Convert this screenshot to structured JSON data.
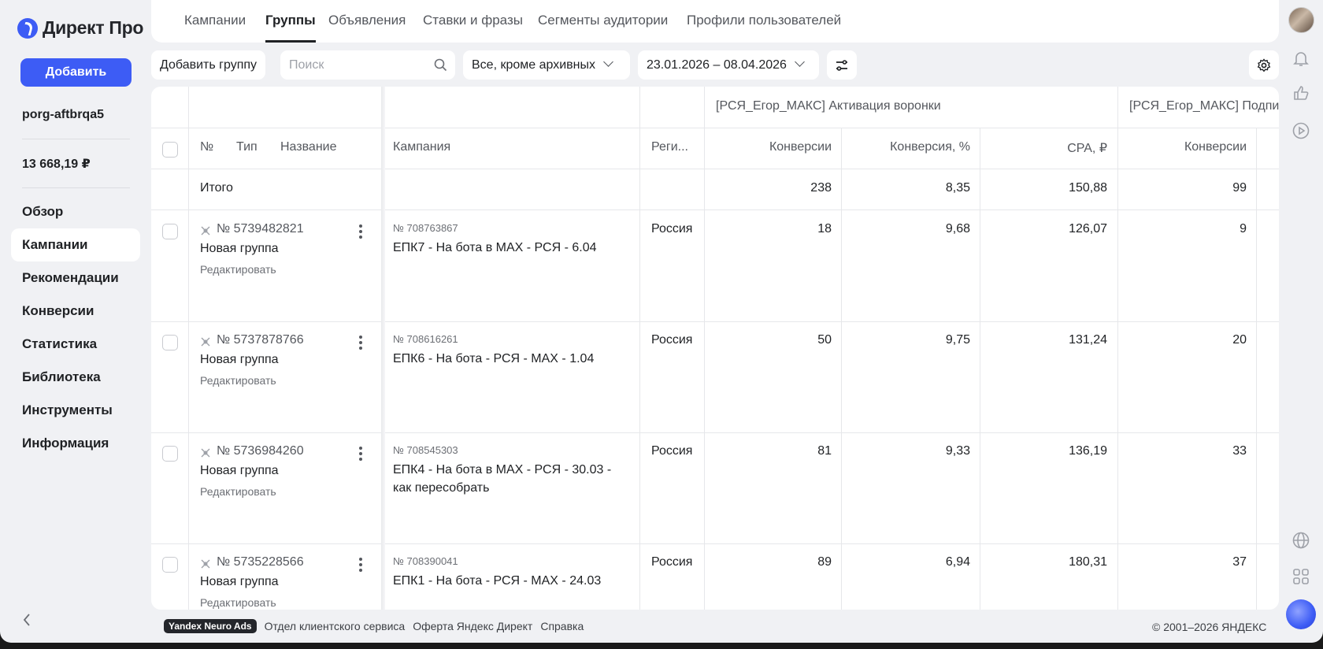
{
  "app": {
    "logo_text": "Директ Про",
    "brand_color": "#3d5cf5"
  },
  "sidebar": {
    "add_label": "Добавить",
    "login": "porg-aftbrqa5",
    "balance": "13 668,19 ₽",
    "items": [
      {
        "label": "Обзор",
        "active": false
      },
      {
        "label": "Кампании",
        "active": true
      },
      {
        "label": "Рекомендации",
        "active": false
      },
      {
        "label": "Конверсии",
        "active": false
      },
      {
        "label": "Статистика",
        "active": false
      },
      {
        "label": "Библиотека",
        "active": false
      },
      {
        "label": "Инструменты",
        "active": false
      },
      {
        "label": "Информация",
        "active": false
      }
    ]
  },
  "tabs": [
    {
      "label": "Кампании",
      "active": false
    },
    {
      "label": "Группы",
      "active": true
    },
    {
      "label": "Объявления",
      "active": false
    },
    {
      "label": "Ставки и фразы",
      "active": false
    },
    {
      "label": "Сегменты аудитории",
      "active": false
    },
    {
      "label": "Профили пользователей",
      "active": false
    }
  ],
  "toolbar": {
    "add_group": "Добавить группу",
    "search_placeholder": "Поиск",
    "status_filter": "Все, кроме архивных",
    "date_range": "23.01.2026 – 08.04.2026"
  },
  "table": {
    "goal_groups": [
      "[РСЯ_Егор_МАКС] Активация воронки",
      "[РСЯ_Егор_МАКС] Подпи"
    ],
    "headers": {
      "num": "№",
      "type": "Тип",
      "name": "Название",
      "campaign": "Кампания",
      "region": "Реги...",
      "conversions": "Конверсии",
      "conv_rate": "Конверсия, %",
      "cpa": "CPA, ₽",
      "conversions2": "Конверсии"
    },
    "total": {
      "label": "Итого",
      "conversions": "238",
      "conv_rate": "8,35",
      "cpa": "150,88",
      "conversions2": "99"
    },
    "rows": [
      {
        "group_id": "№ 5739482821",
        "group_name": "Новая группа",
        "edit": "Редактировать",
        "campaign_id": "№ 708763867",
        "campaign_name": "ЕПК7 - На бота в MAX - РСЯ - 6.04",
        "region": "Россия",
        "conversions": "18",
        "conv_rate": "9,68",
        "cpa": "126,07",
        "conversions2": "9"
      },
      {
        "group_id": "№ 5737878766",
        "group_name": "Новая группа",
        "edit": "Редактировать",
        "campaign_id": "№ 708616261",
        "campaign_name": "ЕПК6 - На бота - РСЯ - MAX - 1.04",
        "region": "Россия",
        "conversions": "50",
        "conv_rate": "9,75",
        "cpa": "131,24",
        "conversions2": "20"
      },
      {
        "group_id": "№ 5736984260",
        "group_name": "Новая группа",
        "edit": "Редактировать",
        "campaign_id": "№ 708545303",
        "campaign_name": "ЕПК4 - На бота в MAX - РСЯ - 30.03 - как пересобрать",
        "region": "Россия",
        "conversions": "81",
        "conv_rate": "9,33",
        "cpa": "136,19",
        "conversions2": "33"
      },
      {
        "group_id": "№ 5735228566",
        "group_name": "Новая группа",
        "edit": "Редактировать",
        "campaign_id": "№ 708390041",
        "campaign_name": "ЕПК1 - На бота - РСЯ - MAX - 24.03",
        "region": "Россия",
        "conversions": "89",
        "conv_rate": "6,94",
        "cpa": "180,31",
        "conversions2": "37"
      }
    ]
  },
  "footer": {
    "badge": "Yandex Neuro Ads",
    "links": [
      "Отдел клиентского сервиса",
      "Оферта Яндекс Директ",
      "Справка"
    ],
    "copyright": "© 2001–2026 ЯНДЕКС"
  },
  "icons": {
    "search": "search-icon",
    "settings": "gear-icon",
    "filters": "sliders-icon",
    "bell": "bell-icon",
    "like": "thumb-up-icon",
    "play": "play-icon",
    "globe": "globe-icon",
    "apps": "apps-grid-icon"
  }
}
